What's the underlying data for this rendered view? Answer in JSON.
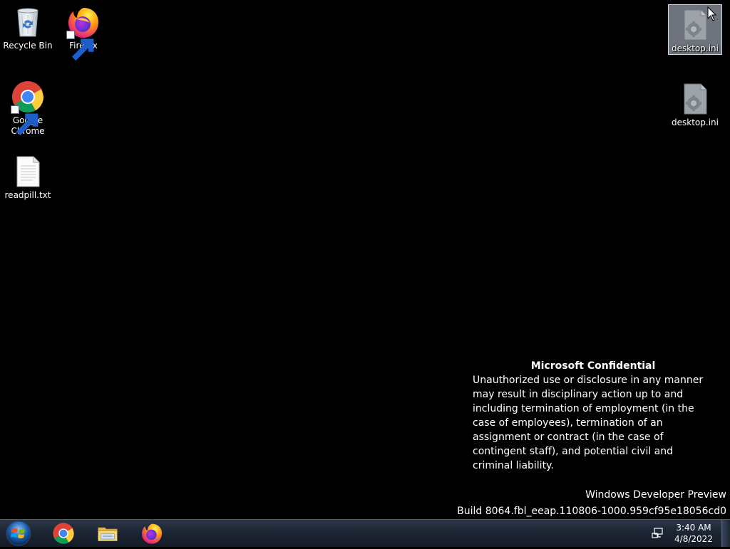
{
  "desktop": {
    "icons": [
      {
        "label": "Recycle Bin"
      },
      {
        "label": "Firefox"
      },
      {
        "label": "Google Chrome"
      },
      {
        "label": "readpill.txt"
      },
      {
        "label": "desktop.ini"
      },
      {
        "label": "desktop.ini"
      }
    ]
  },
  "watermark": {
    "title": "Microsoft Confidential",
    "body": "Unauthorized use or disclosure in any manner may result in disciplinary action up to and including termination of employment (in the case of employees), termination of an assignment or contract (in the case of contingent staff), and potential civil and criminal liability."
  },
  "build": {
    "line1": "Windows Developer Preview",
    "line2": "Build 8064.fbl_eeap.110806-1000.959cf95e18056cd0"
  },
  "taskbar": {
    "apps": [
      "Google Chrome",
      "Windows Explorer",
      "Firefox"
    ],
    "clock_time": "3:40 AM",
    "clock_date": "4/8/2022"
  },
  "icons": {
    "start": "windows-logo-icon",
    "network": "network-icon",
    "recycle": "recycle-bin-icon",
    "chrome": "chrome-icon",
    "firefox": "firefox-icon",
    "explorer": "folder-icon",
    "text": "text-file-icon",
    "ini": "settings-file-icon"
  }
}
